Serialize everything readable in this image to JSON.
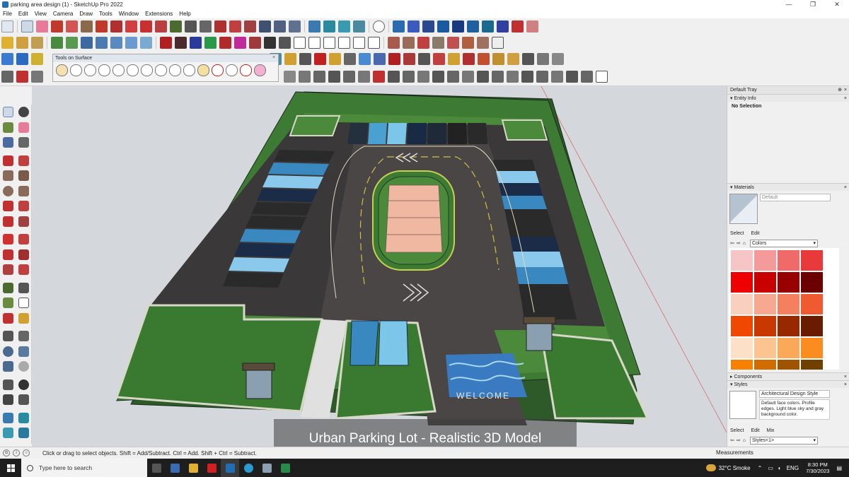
{
  "window": {
    "title": "parking area design (1) - SketchUp Pro 2022",
    "controls": [
      "—",
      "❐",
      "✕"
    ]
  },
  "menu": [
    "File",
    "Edit",
    "View",
    "Camera",
    "Draw",
    "Tools",
    "Window",
    "Extensions",
    "Help"
  ],
  "floating_toolbar": {
    "title": "Tools on Surface"
  },
  "viewport": {
    "caption": "Urban Parking Lot - Realistic 3D Model",
    "welcome_text": "WELCOME"
  },
  "tray": {
    "title": "Default Tray",
    "entity_info": {
      "header": "Entity Info",
      "selection": "No Selection"
    },
    "materials": {
      "header": "Materials",
      "current": "Default",
      "tabs": [
        "Select",
        "Edit"
      ],
      "library": "Colors",
      "swatches": [
        "#f6c5c5",
        "#f49a9a",
        "#f06a6a",
        "#e83a3a",
        "#ee0000",
        "#c80000",
        "#980000",
        "#6a0000",
        "#f9cfc0",
        "#f7a890",
        "#f48060",
        "#f05a30",
        "#f04800",
        "#c83800",
        "#982800",
        "#6a1c00",
        "#fde0c8",
        "#fcc490",
        "#fba858",
        "#fa8c20",
        "#f88000",
        "#d06c00",
        "#a05400",
        "#704000"
      ]
    },
    "components": {
      "header": "Components"
    },
    "styles": {
      "header": "Styles",
      "name": "Architectural Design Style",
      "description": "Default face colors. Profile edges. Light blue sky and gray background color.",
      "tabs": [
        "Select",
        "Edit",
        "Mix"
      ],
      "library": "Styles<1>"
    }
  },
  "statusbar": {
    "hint": "Click or drag to select objects. Shift = Add/Subtract. Ctrl = Add. Shift + Ctrl = Subtract.",
    "measurements_label": "Measurements"
  },
  "taskbar": {
    "search_placeholder": "Type here to search",
    "weather": "32°C  Smoke",
    "language": "ENG",
    "time": "8:30 PM",
    "date": "7/30/2023"
  }
}
